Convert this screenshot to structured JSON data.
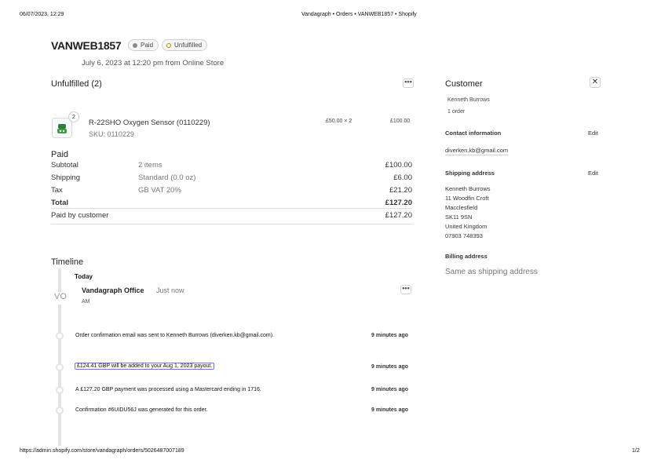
{
  "print_header": {
    "datetime": "06/07/2023, 12:29",
    "page_title": "Vandagraph • Orders • VANWEB1857 • Shopify"
  },
  "print_footer": {
    "url": "https://admin.shopify.com/store/vandagraph/orders/5026487007189",
    "page_number": "1/2"
  },
  "order": {
    "title": "VANWEB1857",
    "badges": [
      {
        "label": "Paid",
        "kind": "paid"
      },
      {
        "label": "Unfulfilled",
        "kind": "unfulfilled"
      }
    ],
    "meta": "July 6, 2023 at 12:20 pm from Online Store"
  },
  "unfulfilled": {
    "heading": "Unfulfilled (2)",
    "more_icon": "ellipsis-icon",
    "item": {
      "quantity_badge": "2",
      "name": "R-22SHO Oxygen Sensor (0110229)",
      "sku": "SKU: 0110229",
      "unit_price_qty": "£50.00 × 2",
      "line_total": "£100.00"
    }
  },
  "payment": {
    "heading": "Paid",
    "rows": [
      {
        "label": "Subtotal",
        "detail": "2 items",
        "amount": "£100.00",
        "bold": false
      },
      {
        "label": "Shipping",
        "detail": "Standard (0.0 oz)",
        "amount": "£6.00",
        "bold": false
      },
      {
        "label": "Tax",
        "detail": "GB VAT 20%",
        "amount": "£21.20",
        "bold": false
      },
      {
        "label": "Total",
        "detail": "",
        "amount": "£127.20",
        "bold": true
      }
    ],
    "paid_by_customer": {
      "label": "Paid by customer",
      "amount": "£127.20"
    }
  },
  "timeline": {
    "heading": "Timeline",
    "today_label": "Today",
    "comment": {
      "avatar": "VO",
      "author": "Vandagraph Office",
      "when": "Just now",
      "sub": "AM"
    },
    "events": [
      {
        "text": "Order confirmation email was sent to Kenneth Burrows (diverken.kb@gmail.com).",
        "time": "9 minutes ago",
        "link": false
      },
      {
        "text": "£124.41 GBP will be added to your Aug 1, 2023 payout.",
        "time": "9 minutes ago",
        "link": true
      },
      {
        "text": "A £127.20 GBP payment was processed using a Mastercard ending in 1716.",
        "time": "9 minutes ago",
        "link": false
      },
      {
        "text": "Confirmation #6UIDU56J was generated for this order.",
        "time": "9 minutes ago",
        "link": false
      }
    ]
  },
  "customer": {
    "heading": "Customer",
    "close_icon": "close-icon",
    "name": "Kenneth Burrows",
    "orders": "1 order",
    "contact": {
      "heading": "Contact information",
      "edit_label": "Edit",
      "email": "diverken.kb@gmail.com"
    },
    "shipping": {
      "heading": "Shipping address",
      "edit_label": "Edit",
      "lines": [
        "Kenneth Burrows",
        "11 Woodfin Croft",
        "Macclesfield",
        "SK11 9SN",
        "United Kingdom",
        "07903 748393"
      ]
    },
    "billing": {
      "heading": "Billing address",
      "text": "Same as shipping address"
    }
  }
}
